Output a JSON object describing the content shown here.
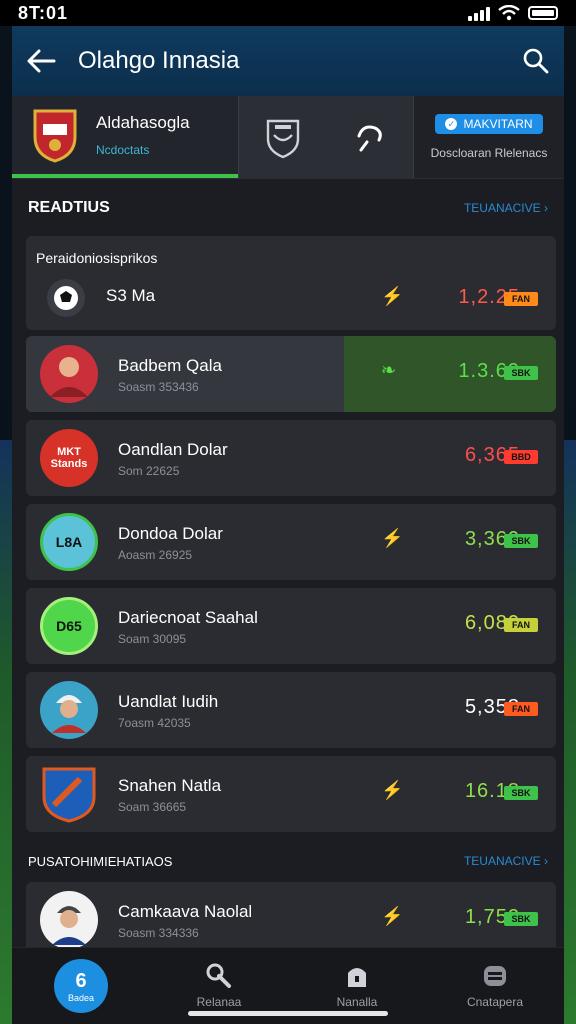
{
  "status_bar": {
    "time": "8T:01"
  },
  "header": {
    "title": "Olahgo Innasia"
  },
  "team_tab": {
    "name": "Aldahasogla",
    "sub": "Ncdoctats"
  },
  "right_tab": {
    "button_label": "MAKVITARN",
    "sub": "Doscloaran Rlelenacs"
  },
  "section": {
    "title": "READTIUS",
    "link": "TEUANACIVE"
  },
  "group": {
    "label": "Peraidoniosisprikos"
  },
  "first_row": {
    "name": "S3 Ma",
    "odds": "1,2.25",
    "badge": "FAN"
  },
  "players": [
    {
      "name": "Badbem Qala",
      "sub": "Soasm 353436",
      "odds": "1.3.69",
      "badge": "SBK",
      "odds_color": "#5be04a",
      "badge_color": "#3fc24a",
      "icon": "leaf-icon",
      "highlight": true
    },
    {
      "name": "Oandlan Dolar",
      "sub": "Som 22625",
      "odds": "6,365",
      "badge": "BBD",
      "odds_color": "#ff4d4d",
      "badge_color": "#ff3b30",
      "icon": "",
      "avatar_text": "MKT Stands"
    },
    {
      "name": "Dondoa Dolar",
      "sub": "Aoasm 26925",
      "odds": "3,360",
      "badge": "SBK",
      "odds_color": "#8ee04a",
      "badge_color": "#3fc24a",
      "icon": "flash-icon",
      "avatar_text": "L8A"
    },
    {
      "name": "Dariecnoat Saahal",
      "sub": "Soam 30095",
      "odds": "6,080",
      "badge": "FAN",
      "odds_color": "#c6e04a",
      "badge_color": "#c6d03a",
      "icon": "",
      "avatar_text": "D65"
    },
    {
      "name": "Uandlat Iudih",
      "sub": "7oasm 42035",
      "odds": "5,358",
      "badge": "FAN",
      "odds_color": "#ffffff",
      "badge_color": "#ff5a1f",
      "icon": ""
    },
    {
      "name": "Snahen Natla",
      "sub": "Soam 36665",
      "odds": "16.18",
      "badge": "SBK",
      "odds_color": "#8ee04a",
      "badge_color": "#3fc24a",
      "icon": "flash-icon"
    }
  ],
  "section2": {
    "title": "PUSATOHIMIEHATIAOS",
    "link": "TEUANACIVE"
  },
  "second_row": {
    "name": "Camkaava Naolal",
    "sub": "Soasm 334336",
    "odds": "1,752",
    "badge": "SBK"
  },
  "nav": {
    "active_num": "6",
    "active_label": "Badea",
    "items": [
      "Relanaa",
      "Nanalla",
      "Cnatapera"
    ]
  },
  "colors": {
    "accent": "#1d8fe0",
    "green": "#3fc24a",
    "red": "#ff3b30",
    "header": "#0f3a5e"
  }
}
